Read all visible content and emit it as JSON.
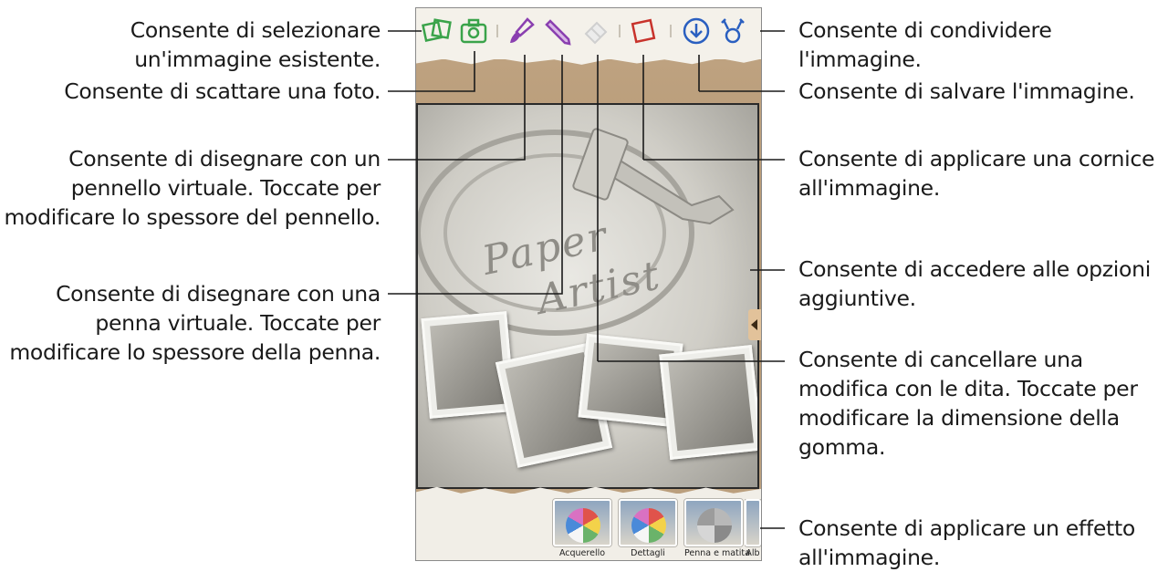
{
  "screen": {
    "toolbar": {
      "icons": [
        "gallery-icon",
        "camera-icon",
        "brush-icon",
        "pen-icon",
        "eraser-icon",
        "frame-icon",
        "save-icon",
        "share-icon"
      ],
      "colors": {
        "green": "#3aa34a",
        "purple": "#8a3fb0",
        "red": "#c8332c",
        "blue": "#2a5fc0",
        "eraser": "#cfcfcf"
      }
    },
    "canvas": {
      "title_line1": "Paper",
      "title_line2": "Artist"
    },
    "effects": [
      {
        "label": "Acquerello"
      },
      {
        "label": "Dettagli"
      },
      {
        "label": "Penna e matita"
      },
      {
        "label": "Alb"
      }
    ]
  },
  "callouts_left": {
    "select_image": [
      "Consente di selezionare",
      "un'immagine esistente."
    ],
    "take_photo": [
      "Consente di scattare una foto."
    ],
    "brush": [
      "Consente di disegnare con un",
      "pennello virtuale. Toccate per",
      "modificare lo spessore del pennello."
    ],
    "pen": [
      "Consente di disegnare con una",
      "penna virtuale. Toccate per",
      "modificare lo spessore della penna."
    ]
  },
  "callouts_right": {
    "share": [
      "Consente di condividere",
      "l'immagine."
    ],
    "save": [
      "Consente di salvare l'immagine."
    ],
    "frame": [
      "Consente di applicare una cornice",
      "all'immagine."
    ],
    "options": [
      "Consente di accedere alle opzioni",
      "aggiuntive."
    ],
    "erase": [
      "Consente di cancellare una",
      "modifica con le dita. Toccate per",
      "modificare la dimensione della",
      "gomma."
    ],
    "effect": [
      "Consente di applicare un effetto",
      "all'immagine."
    ]
  }
}
